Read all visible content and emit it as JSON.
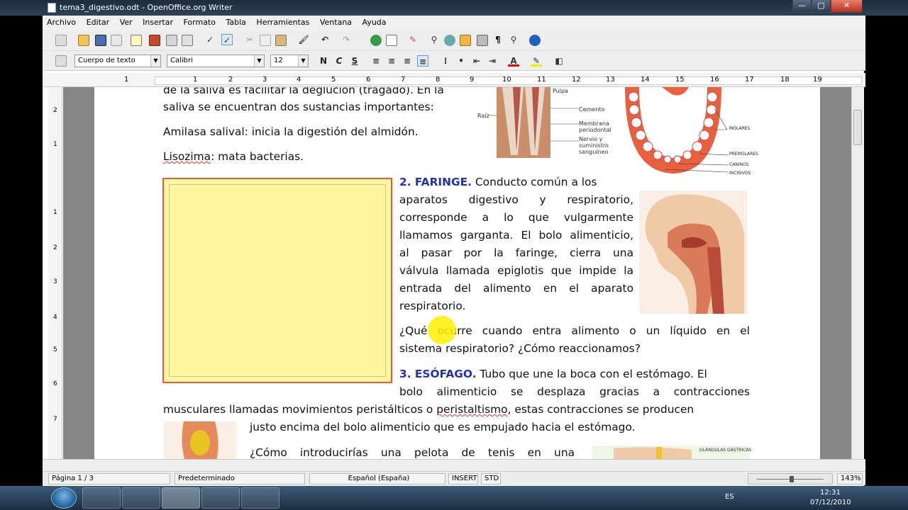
{
  "window": {
    "title": "tema3_digestivo.odt - OpenOffice.org Writer",
    "min_label": "—",
    "max_label": "▢",
    "close_label": "✕"
  },
  "menu": [
    "Archivo",
    "Editar",
    "Ver",
    "Insertar",
    "Formato",
    "Tabla",
    "Herramientas",
    "Ventana",
    "Ayuda"
  ],
  "format_bar": {
    "style": "Cuerpo de texto",
    "font": "Calibri",
    "size": "12",
    "bold": "N",
    "italic": "C",
    "underline": "S"
  },
  "ruler_numbers": [
    "1",
    "1",
    "2",
    "3",
    "4",
    "5",
    "6",
    "7",
    "8",
    "9",
    "10",
    "11",
    "12",
    "13",
    "14",
    "15",
    "16",
    "17",
    "18",
    "19"
  ],
  "vruler_numbers": [
    "2",
    "1",
    "1",
    "2",
    "3",
    "4",
    "5",
    "6",
    "7"
  ],
  "document": {
    "line1": "de la saliva es facilitar la deglución (tragado). En la",
    "line2": "saliva se encuentran dos sustancias importantes:",
    "amilasa": "Amilasa salival: inicia la digestión del almidón.",
    "lisozima_word": "Lisozima",
    "lisozima_rest": ": mata bacterias.",
    "faringe_title": "2. FARINGE.",
    "faringe_lines": [
      " Conducto común a los",
      "aparatos digestivo y respiratorio,",
      "corresponde a lo que vulgarmente",
      "llamamos garganta. El bolo alimenticio,",
      "al pasar por la faringe, cierra una",
      "válvula llamada epiglotis que impide la",
      "entrada del alimento en el aparato",
      "respiratorio."
    ],
    "question1_a": "¿Qué ocurre cuando entra alimento o un líquido en el",
    "question1_b": "sistema respiratorio? ¿Cómo reaccionamos?",
    "esofago_title": "3. ESÓFAGO.",
    "esofago_l1": " Tubo que une la boca con el estómago. El",
    "esofago_l2": "bolo alimenticio se desplaza gracias a contracciones",
    "esofago_l3a": "musculares llamadas movimientos peristálticos o ",
    "esofago_l3b": "peristaltismo",
    "esofago_l3c": ", estas contracciones se producen",
    "esofago_l4": "justo encima del bolo alimenticio que es empujado hacia el estómago.",
    "question2": "¿Cómo introducirías una pelota de tenis en una"
  },
  "tooth_labels": [
    "Pulpa",
    "Cemento",
    "Membrana periodontal",
    "Nervio y suministro sanguíneo",
    "Raíz"
  ],
  "jaw_labels": [
    "MOLARES",
    "PREMOLARES",
    "CANINOS",
    "INCISIVOS"
  ],
  "gland_label": "GLÁNDULAS GÁSTRICAS",
  "status": {
    "page": "Página  1 / 3",
    "style": "Predeterminado",
    "language": "Español (España)",
    "insert": "INSERT",
    "std": "STD",
    "zoom": "143%"
  },
  "taskbar": {
    "lang": "ES",
    "time": "12:31",
    "date": "07/12/2010"
  },
  "colors": {
    "heading_blue": "#2233aa",
    "box_fill": "#fef6a0",
    "box_border": "#e25c3c"
  }
}
